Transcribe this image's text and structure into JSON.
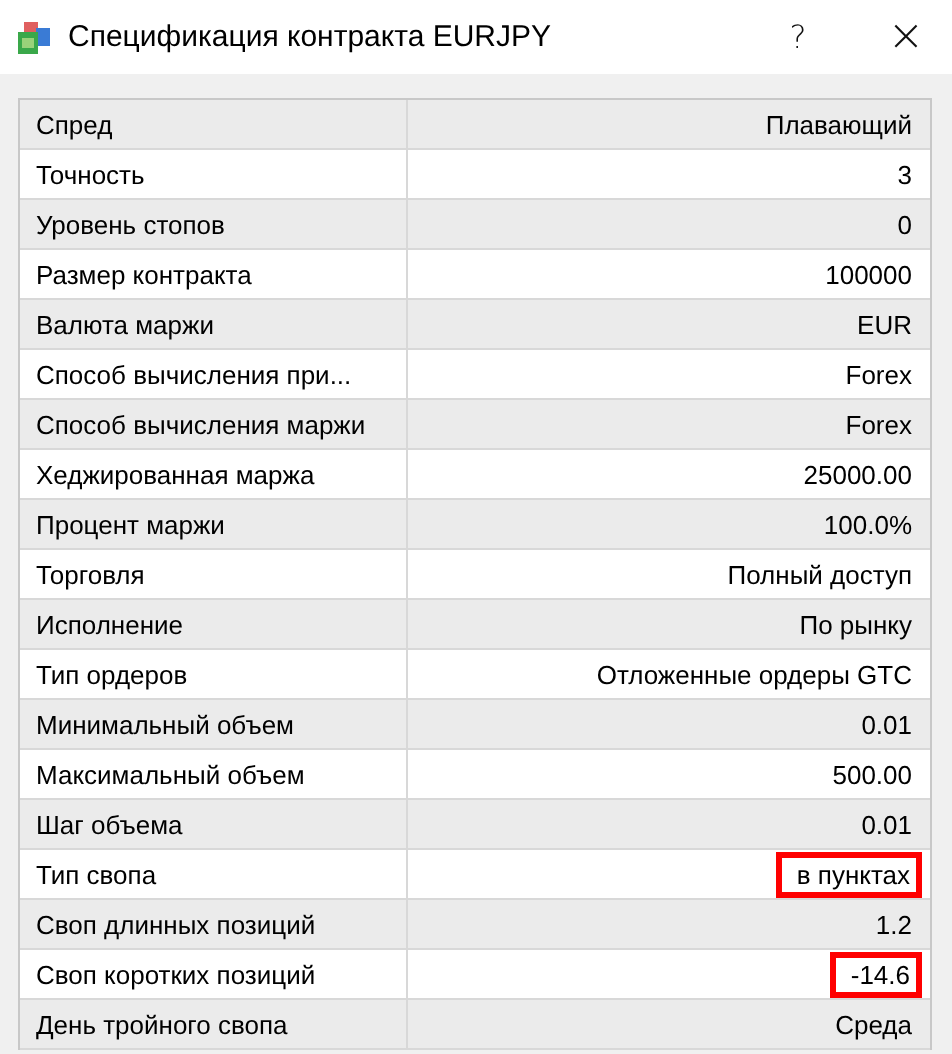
{
  "window": {
    "title": "Спецификация контракта EURJPY",
    "help": "?",
    "close": "×"
  },
  "rows": [
    {
      "label": "Спред",
      "value": "Плавающий",
      "highlighted": false
    },
    {
      "label": "Точность",
      "value": "3",
      "highlighted": false
    },
    {
      "label": "Уровень стопов",
      "value": "0",
      "highlighted": false
    },
    {
      "label": "Размер контракта",
      "value": "100000",
      "highlighted": false
    },
    {
      "label": "Валюта маржи",
      "value": "EUR",
      "highlighted": false
    },
    {
      "label": "Способ вычисления при...",
      "value": "Forex",
      "highlighted": false
    },
    {
      "label": "Способ вычисления маржи",
      "value": "Forex",
      "highlighted": false
    },
    {
      "label": "Хеджированная маржа",
      "value": "25000.00",
      "highlighted": false
    },
    {
      "label": "Процент маржи",
      "value": "100.0%",
      "highlighted": false
    },
    {
      "label": "Торговля",
      "value": "Полный доступ",
      "highlighted": false
    },
    {
      "label": "Исполнение",
      "value": "По рынку",
      "highlighted": false
    },
    {
      "label": "Тип ордеров",
      "value": "Отложенные ордеры GTC",
      "highlighted": false
    },
    {
      "label": "Минимальный объем",
      "value": "0.01",
      "highlighted": false
    },
    {
      "label": "Максимальный объем",
      "value": "500.00",
      "highlighted": false
    },
    {
      "label": "Шаг объема",
      "value": "0.01",
      "highlighted": false
    },
    {
      "label": "Тип свопа",
      "value": "в пунктах",
      "highlighted": true
    },
    {
      "label": "Своп длинных позиций",
      "value": "1.2",
      "highlighted": false
    },
    {
      "label": "Своп коротких позиций",
      "value": "-14.6",
      "highlighted": true
    },
    {
      "label": "День тройного свопа",
      "value": "Среда",
      "highlighted": false
    }
  ]
}
